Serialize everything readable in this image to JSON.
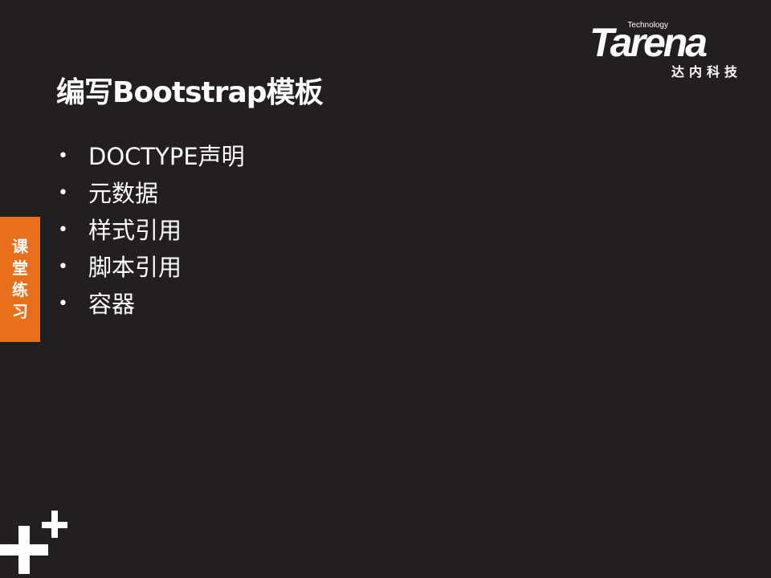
{
  "logo": {
    "tagline": "Technology",
    "wordmark": "Tarena",
    "cn_name": "达内科技"
  },
  "slide": {
    "title": "编写Bootstrap模板",
    "bullets": [
      "DOCTYPE声明",
      "元数据",
      "样式引用",
      "脚本引用",
      "容器"
    ]
  },
  "side_tab": {
    "chars": [
      "课",
      "堂",
      "练",
      "习"
    ]
  },
  "colors": {
    "background": "#231f20",
    "accent": "#e8701c",
    "text": "#ffffff"
  },
  "icons": {
    "decoration": "plus-plus-icon"
  }
}
